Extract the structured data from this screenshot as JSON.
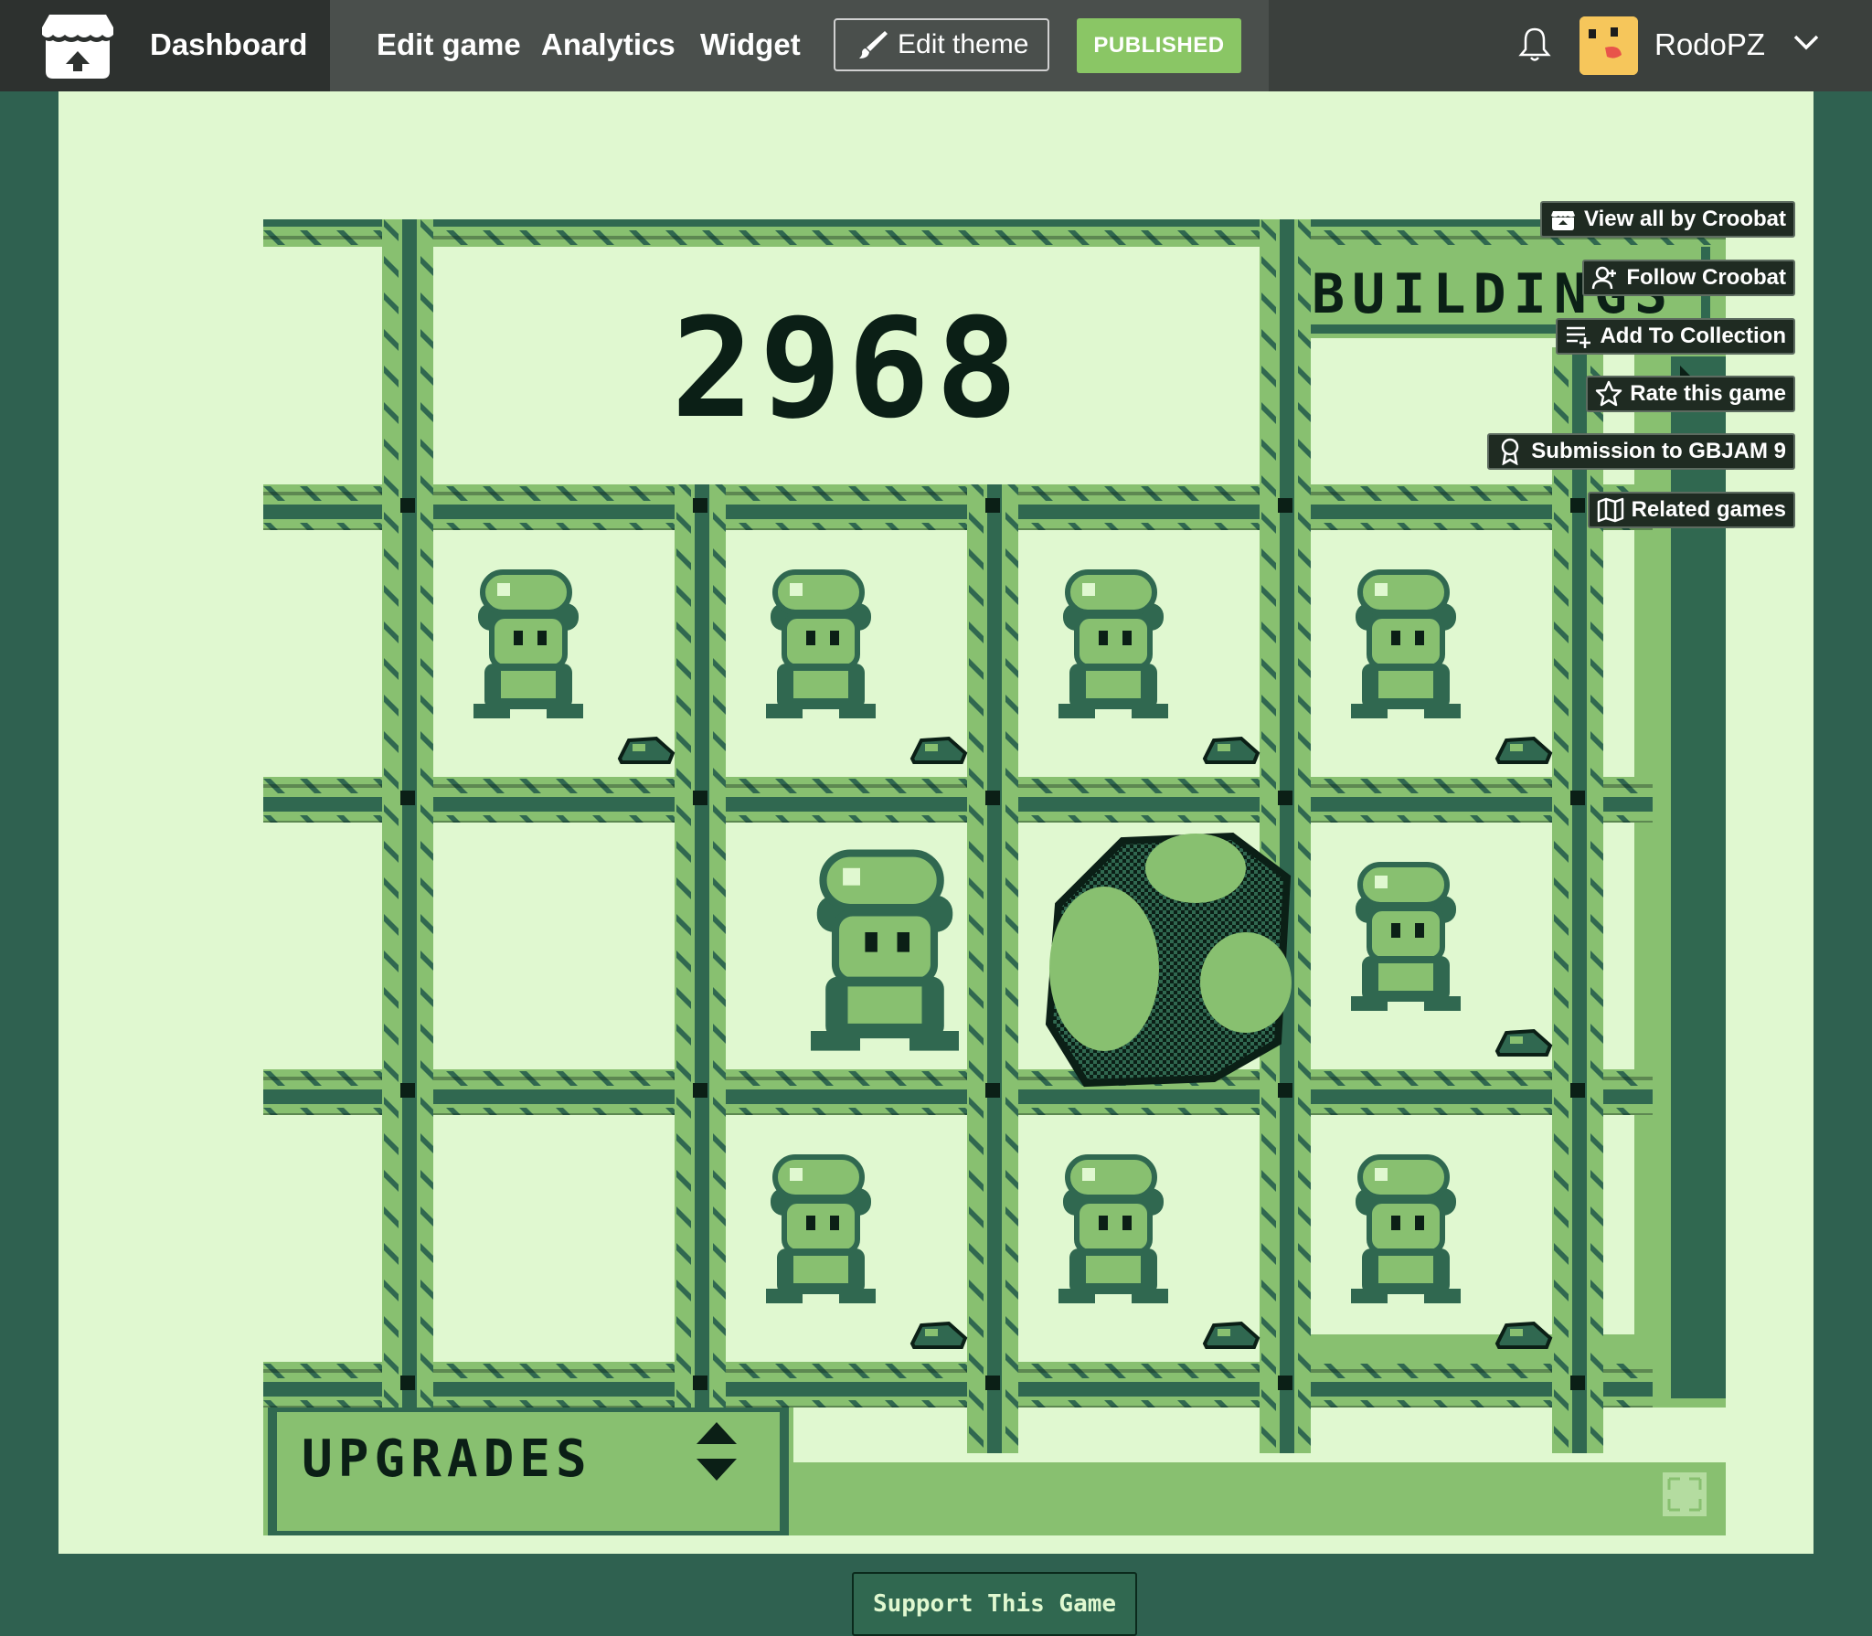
{
  "topbar": {
    "dashboard": "Dashboard",
    "edit_game": "Edit game",
    "analytics": "Analytics",
    "widget": "Widget",
    "edit_theme": "Edit theme",
    "published": "PUBLISHED",
    "username": "RodoPZ"
  },
  "game": {
    "score": "2968",
    "buildings_label": "BUILDINGS",
    "upgrades_label": "UPGRADES"
  },
  "side_buttons": {
    "view_all": "View all by Croobat",
    "follow": "Follow Croobat",
    "add_collection": "Add To Collection",
    "rate": "Rate this game",
    "submission": "Submission to GBJAM 9",
    "related": "Related games"
  },
  "support": "Support This Game",
  "colors": {
    "gb_light": "#e0f8d0",
    "gb_mid": "#88c070",
    "gb_dark": "#306850",
    "gb_darkest": "#0b1f16",
    "published": "#8ac665"
  }
}
